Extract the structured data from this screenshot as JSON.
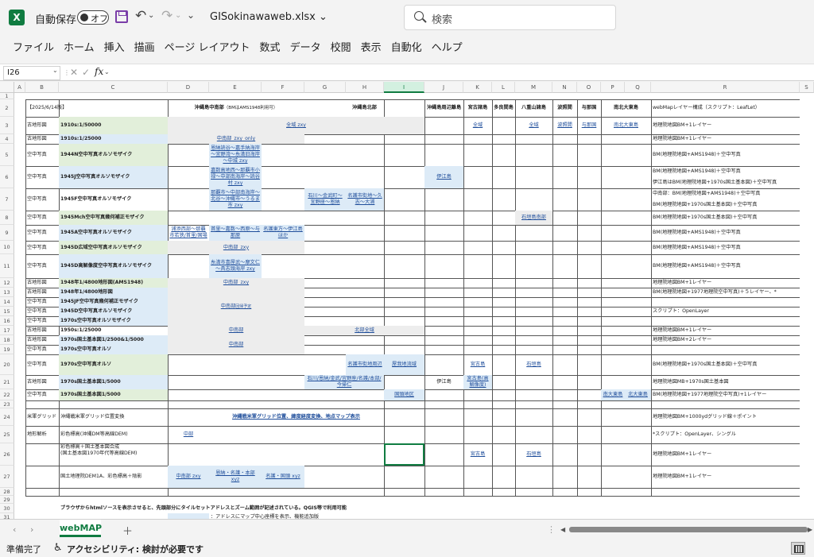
{
  "app": {
    "logo": "X",
    "autosave_label": "自動保存",
    "autosave_state": "オフ",
    "filename": "GISokinawaweb.xlsx",
    "search_placeholder": "検索"
  },
  "menu": [
    "ファイル",
    "ホーム",
    "挿入",
    "描画",
    "ページ レイアウト",
    "数式",
    "データ",
    "校閲",
    "表示",
    "自動化",
    "ヘルプ"
  ],
  "formula_bar": {
    "namebox": "I26"
  },
  "columns": [
    "A",
    "B",
    "C",
    "D",
    "E",
    "F",
    "G",
    "H",
    "I",
    "J",
    "K",
    "L",
    "M",
    "N",
    "O",
    "P",
    "Q",
    "R",
    "S"
  ],
  "selected_column": "I",
  "rows": [
    "1",
    "2",
    "3",
    "4",
    "5",
    "6",
    "7",
    "8",
    "9",
    "10",
    "11",
    "12",
    "13",
    "14",
    "15",
    "16",
    "17",
    "18",
    "19",
    "20",
    "21",
    "22",
    "23",
    "24",
    "25",
    "26",
    "27",
    "28",
    "29",
    "30",
    "31"
  ],
  "header_row": {
    "date": "【2025/6/14版】",
    "okinawa_central_south": "沖縄島中南部",
    "okinawa_central_south_note": "（BMはAMS1948利用可）",
    "okinawa_north": "沖縄島北部",
    "okinawa_islands": "沖縄島周辺離島",
    "miyako": "宮古諸島",
    "tarama": "多良間島",
    "yaeyama": "八重山諸島",
    "hateruma": "波照間",
    "yonaguni": "与那国",
    "minamidaito": "南北大東島",
    "webmap": "webMapレイヤー構成（スクリプト：LeafLet）"
  },
  "body_rows": [
    {
      "cat": "古地形図",
      "name": "1910s:1/50000",
      "bg": "green"
    },
    {
      "cat": "古地形図",
      "name": "1910s:1/25000",
      "bg": "blue"
    },
    {
      "cat": "空中写真",
      "name": "1944N空中写真オルソモザイク",
      "bg": "green"
    },
    {
      "cat": "空中写真",
      "name": "1945J空中写真オルソモザイク",
      "bg": "blue"
    },
    {
      "cat": "空中写真",
      "name": "1945F空中写真オルソモザイク",
      "bg": ""
    },
    {
      "cat": "空中写真",
      "name": "1945Mch空中写真幾何補正モザイク",
      "bg": "green"
    },
    {
      "cat": "空中写真",
      "name": "1945A空中写真オルソモザイク",
      "bg": "blue"
    },
    {
      "cat": "空中写真",
      "name": "1945D広域空中写真オルソモザイク",
      "bg": "green"
    },
    {
      "cat": "空中写真",
      "name": "1945D高解像度空中写真オルソモザイク",
      "bg": "blue"
    },
    {
      "cat": "古地形図",
      "name": "1948年1/4800地形図(AMS1948)",
      "bg": "green"
    }
  ],
  "r14_names": [
    "1948年1/4800地形図",
    "1945JF空中写真幾何補正モザイク",
    "1945D空中写真オルソモザイク",
    "1970s空中写真オルソモザイク"
  ],
  "r14_cats": [
    "古地形図",
    "空中写真",
    "空中写真",
    "空中写真"
  ],
  "r17": {
    "cat": "古地形図",
    "name": "1950s:1/25000"
  },
  "r18_cats": [
    "古地形図",
    "空中写真"
  ],
  "r18_names": [
    "1970s国土基本図1/2500&1/5000",
    "1970s空中写真オルソ"
  ],
  "r20": {
    "cat": "空中写真",
    "name": "1970s空中写真オルソ"
  },
  "r21": {
    "cat": "古地形図",
    "name": "1970s国土基本図1/5000"
  },
  "r22": {
    "cat": "空中写真",
    "name": "1970s国土基本図1/5000"
  },
  "r24": {
    "cat": "米軍グリッド",
    "name": "沖縄戦米軍グリッド位置変換"
  },
  "r25": {
    "cat": "地形解析",
    "name": "彩色標高(沖縄DM等高線DEM)"
  },
  "r26_name_1": "彩色標高＋国土基本図合成",
  "r26_name_2": "(国土基本図1970年代等高線DEM)",
  "r27_name": "国土地理院DEM1A、彩色標高＋陰影",
  "links": {
    "r3_all": "全域 zxy",
    "r3_miyako": "全域",
    "r3_yaeyama": "全域",
    "r3_hateruma": "波照間",
    "r3_yonaguni": "与那国",
    "r3_daito": "南北大東島",
    "r4_cs": "中南部_zxy_only",
    "r5_cs": "恩納読谷～嘉手納海岸～宜野湾～糸満旧海岸～中城 zxy",
    "r6_cs": "嘉数高地西～那覇市小禄～中部南海岸～読谷村 zxy",
    "r6_islands": "伊江島",
    "r7_cs": "那覇市～中部南海岸～北谷～沖縄市～うるま市 zxy",
    "r7_n1": "石川～金武町～宜野座～恩納",
    "r7_n2": "名護市街地～久志～大浦",
    "r8_yaeyama": "石垣島南部",
    "r9_d": "浦添西部～那覇市若狭/首里/国場",
    "r9_e": "首里～嘉数～西原～与那原",
    "r9_f": "名護東方～伊江島ほか",
    "r10_cs": "中南部_zxy",
    "r11_cs": "糸満市喜屋武～摩文仁～具志頭海岸 zxy",
    "r13_cs": "中南部_zxy",
    "r15_cs": "中南部",
    "r15_note": "回帰予定",
    "r17_cs": "中南部",
    "r17_n": "北部全域",
    "r18_cs": "中南部",
    "r20_h": "名護市街地周辺",
    "r20_i": "屋我地流域",
    "r20_miyako": "宮古島",
    "r20_yaeyama": "石垣島",
    "r21_g": "石川/恩納/金武/宜野座/名護/本部/今帰仁",
    "r21_islands": "伊江島",
    "r21_miyako": "宮古島(高解像度)",
    "r22_i": "国頭地区",
    "r22_p": "南大東島",
    "r22_q": "北大東島",
    "r24_cs": "沖縄戦米軍グリッド位置、緯度経度変換、地点マップ表示",
    "r25_cs": "中部",
    "r26_miyako": "宮古島",
    "r26_yaeyama": "石垣島",
    "r27_d": "中南部 zxy",
    "r27_e": "恩納・名護・本部 xyz",
    "r27_f": "名護・国頭 xyz"
  },
  "webmap": [
    "地理院地図BM+1レイヤー",
    "地理院地図BM+1レイヤー",
    "BM(地理院地図+AMS1948)＋空中写真",
    "BM(地理院地図+AMS1948)＋空中写真",
    "伊江島はBM(地理院地図+1970s国土基本図)＋空中写真",
    "中南部：BM(地理院地図+AMS1948)＋空中写真",
    "BM(地理院地図+1970s国土基本図)＋空中写真",
    "BM(地理院地図+1970s国土基本図)＋空中写真",
    "BM(地理院地図+AMS1948)＋空中写真",
    "BM(地理院地図+AMS1948)＋空中写真",
    "BM(地理院地図+AMS1948)＋空中写真",
    "地理院地図BM+1レイヤー",
    "BM(地理院地図+1977地理院空中写真)＋５レイヤー、*",
    "スクリプト：OpenLayer",
    "地理院地図BM+1レイヤー",
    "地理院地図BM+2レイヤー",
    "BM(地理院地図+1970s国土基本図)＋空中写真",
    "地理院地図MB+1970s国土基本図",
    "BM(地理院地図+1977地理院空中写真)+1レイヤー",
    "地理院地図BM+1000ydグリッド線＋ポイント",
    "*スクリプト：OpenLayer、シングル",
    "地理院地図BM+1レイヤー",
    "地理院地図BM+1レイヤー"
  ],
  "footer_note": "ブラウザからhtmlソースを表示させると、先頭部分にタイルセットアドレスとズーム範囲が記述されている。QGIS等で利用可能",
  "footer_note2": "：アドレスにマップ中心座標を表示、機能追加版",
  "sheet_tab": "webMAP",
  "status": {
    "ready": "準備完了",
    "accessibility": "アクセシビリティ: 検討が必要です"
  }
}
